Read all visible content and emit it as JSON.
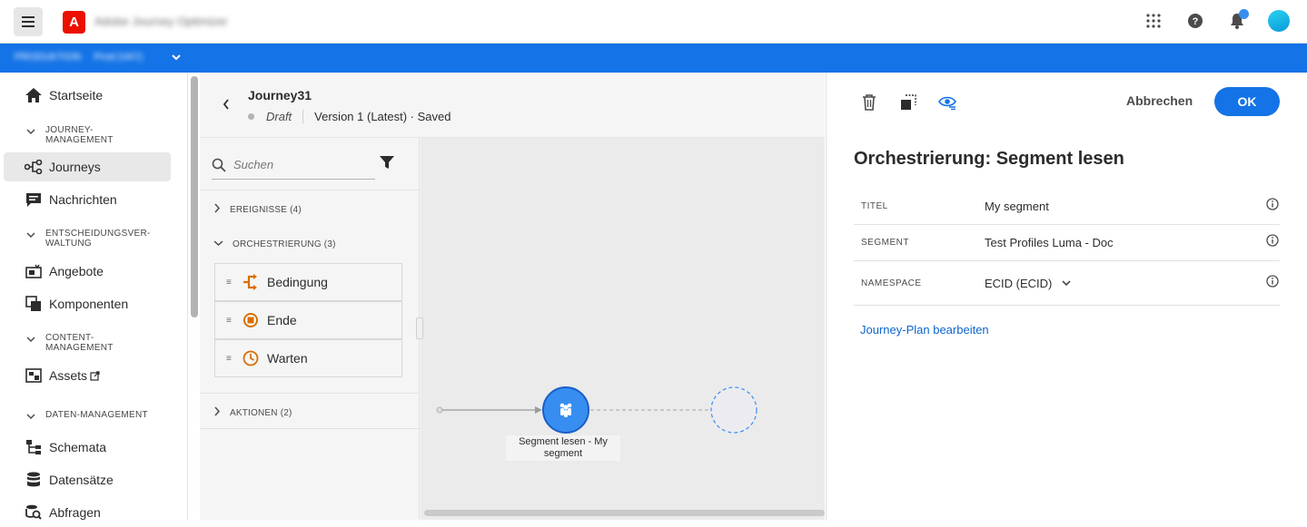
{
  "topbar": {
    "app_name": "Adobe Journey Optimizer",
    "icons": [
      "menu-icon",
      "adobe-logo",
      "apps-grid-icon",
      "help-icon",
      "bell-icon",
      "avatar"
    ]
  },
  "orgbar": {
    "org": "PRODUKTION",
    "sandbox": "Prod (VA7)"
  },
  "sidebar": {
    "home": "Startseite",
    "journey_section": [
      "JOURNEY-",
      "MANAGEMENT"
    ],
    "journeys": "Journeys",
    "messages": "Nachrichten",
    "decision_section": [
      "ENTSCHEIDUNGSVER-",
      "WALTUNG"
    ],
    "offers": "Angebote",
    "components": "Komponenten",
    "content_section": [
      "CONTENT-",
      "MANAGEMENT"
    ],
    "assets": "Assets",
    "data_section": "DATEN-MANAGEMENT",
    "schemas": "Schemata",
    "datasets": "Datensätze",
    "queries": "Abfragen"
  },
  "journey": {
    "title": "Journey31",
    "status": "Draft",
    "version": "Version 1 (Latest) · Saved"
  },
  "palette": {
    "search_placeholder": "Suchen",
    "events": "EREIGNISSE (4)",
    "orchestration": "ORCHESTRIERUNG (3)",
    "items": [
      {
        "label": "Bedingung"
      },
      {
        "label": "Ende"
      },
      {
        "label": "Warten"
      }
    ],
    "actions": "AKTIONEN (2)"
  },
  "canvas": {
    "node_label_line1": "Segment lesen - My",
    "node_label_line2": "segment"
  },
  "props": {
    "cancel": "Abbrechen",
    "ok": "OK",
    "title": "Orchestrierung: Segment lesen",
    "rows": [
      {
        "label": "TITEL",
        "value": "My segment"
      },
      {
        "label": "SEGMENT",
        "value": "Test Profiles Luma - Doc"
      },
      {
        "label": "NAMESPACE",
        "value": "ECID (ECID)"
      }
    ],
    "edit_link": "Journey-Plan bearbeiten"
  },
  "colors": {
    "accent": "#1473e6",
    "orchestration_icon": "#d86f00",
    "node": "#378ef0"
  }
}
